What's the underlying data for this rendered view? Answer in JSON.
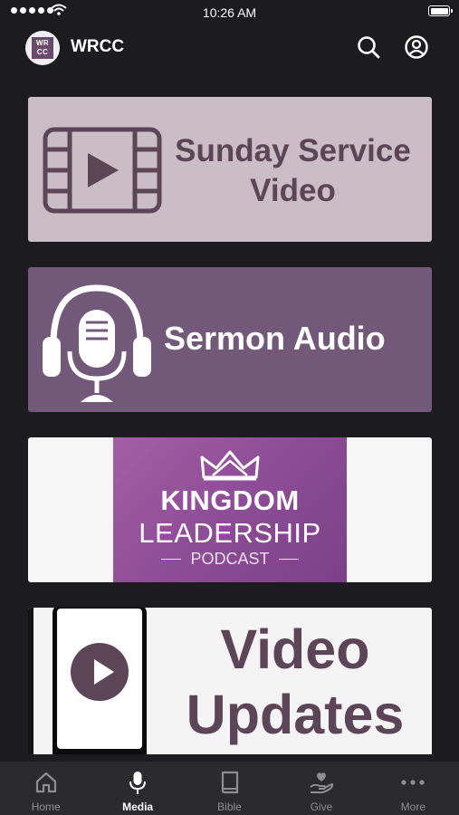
{
  "status_bar": {
    "time": "10:26 AM"
  },
  "app_bar": {
    "title": "WRCC",
    "logo_text_line1": "WR",
    "logo_text_line2": "CC",
    "icons": [
      "search-icon",
      "profile-icon"
    ]
  },
  "tiles": [
    {
      "label": "Sunday Service Video",
      "line1": "Sunday Service",
      "line2": "Video",
      "icon": "film-play-icon"
    },
    {
      "label": "Sermon Audio",
      "icon": "podcast-microphone-headphones-icon"
    },
    {
      "label": "Kingdom Leadership Podcast",
      "line1": "KINGDOM",
      "line2": "LEADERSHIP",
      "line3": "PODCAST",
      "icon": "crown-icon"
    },
    {
      "label": "Video Updates",
      "line1": "Video",
      "line2": "Updates",
      "icon": "phone-play-icon"
    }
  ],
  "tab_bar": {
    "active": "Media",
    "items": [
      {
        "label": "Home",
        "icon": "home-icon"
      },
      {
        "label": "Media",
        "icon": "microphone-icon"
      },
      {
        "label": "Bible",
        "icon": "book-icon"
      },
      {
        "label": "Give",
        "icon": "give-hand-heart-icon"
      },
      {
        "label": "More",
        "icon": "more-dots-icon"
      }
    ]
  },
  "colors": {
    "background": "#1c1c1e",
    "brand_purple": "#5c4557",
    "tile_light_mauve": "#cbbdc5",
    "tile_purple": "#72597a",
    "podcast_purple": "#8b4b95",
    "tab_bar": "#2b2b2d"
  }
}
